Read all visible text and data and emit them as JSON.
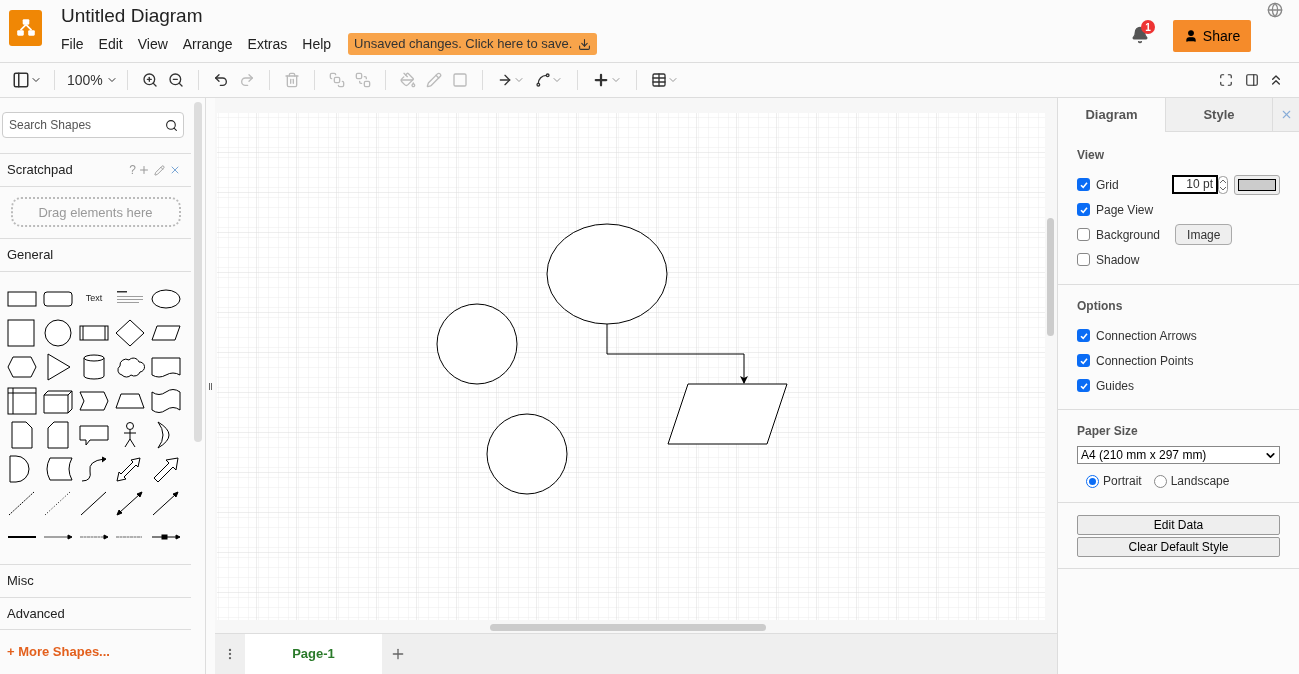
{
  "header": {
    "title": "Untitled Diagram",
    "menu": [
      "File",
      "Edit",
      "View",
      "Arrange",
      "Extras",
      "Help"
    ],
    "unsaved_banner": "Unsaved changes. Click here to save.",
    "notifications": "1",
    "share_button": "Share"
  },
  "toolbar": {
    "zoom": "100%",
    "tools": [
      {
        "kind": "zoom-in",
        "disabled": false
      },
      {
        "kind": "zoom-out",
        "disabled": false
      },
      {
        "kind": "undo",
        "disabled": false
      },
      {
        "kind": "redo",
        "disabled": true
      },
      {
        "kind": "delete",
        "disabled": true
      },
      {
        "kind": "to-front",
        "disabled": true
      },
      {
        "kind": "to-back",
        "disabled": true
      },
      {
        "kind": "fill",
        "disabled": true
      },
      {
        "kind": "line",
        "disabled": true
      },
      {
        "kind": "shadow",
        "disabled": true
      },
      {
        "kind": "connection",
        "disabled": false
      },
      {
        "kind": "waypoints",
        "disabled": false
      },
      {
        "kind": "insert",
        "disabled": false
      },
      {
        "kind": "table",
        "disabled": false
      }
    ]
  },
  "sidebar": {
    "search": {
      "placeholder": "Search Shapes"
    },
    "scratchpad": {
      "title": "Scratchpad",
      "help": "?",
      "drop_hint": "Drag elements here"
    },
    "sections": [
      {
        "title": "General",
        "expanded": true,
        "text_shape": "Text"
      },
      {
        "title": "Misc",
        "expanded": false
      },
      {
        "title": "Advanced",
        "expanded": false
      }
    ],
    "more_shapes": "+ More Shapes..."
  },
  "pages": [
    {
      "label": "Page-1",
      "selected": true
    }
  ],
  "format_panel": {
    "tabs": [
      {
        "label": "Diagram",
        "selected": true
      },
      {
        "label": "Style",
        "selected": false
      }
    ],
    "view": {
      "title": "View",
      "items": [
        {
          "kind": "grid",
          "label": "Grid",
          "checked": true,
          "value": "10 pt"
        },
        {
          "kind": "plain",
          "label": "Page View",
          "checked": true
        },
        {
          "kind": "background",
          "label": "Background",
          "checked": false,
          "button": "Image"
        },
        {
          "kind": "plain",
          "label": "Shadow",
          "checked": false
        }
      ]
    },
    "options": {
      "title": "Options",
      "items": [
        {
          "label": "Connection Arrows",
          "checked": true
        },
        {
          "label": "Connection Points",
          "checked": true
        },
        {
          "label": "Guides",
          "checked": true
        }
      ]
    },
    "paper": {
      "title": "Paper Size",
      "value": "A4 (210 mm x 297 mm)",
      "orientations": [
        {
          "label": "Portrait",
          "selected": true
        },
        {
          "label": "Landscape",
          "selected": false
        }
      ]
    },
    "buttons": [
      "Edit Data",
      "Clear Default Style"
    ]
  }
}
